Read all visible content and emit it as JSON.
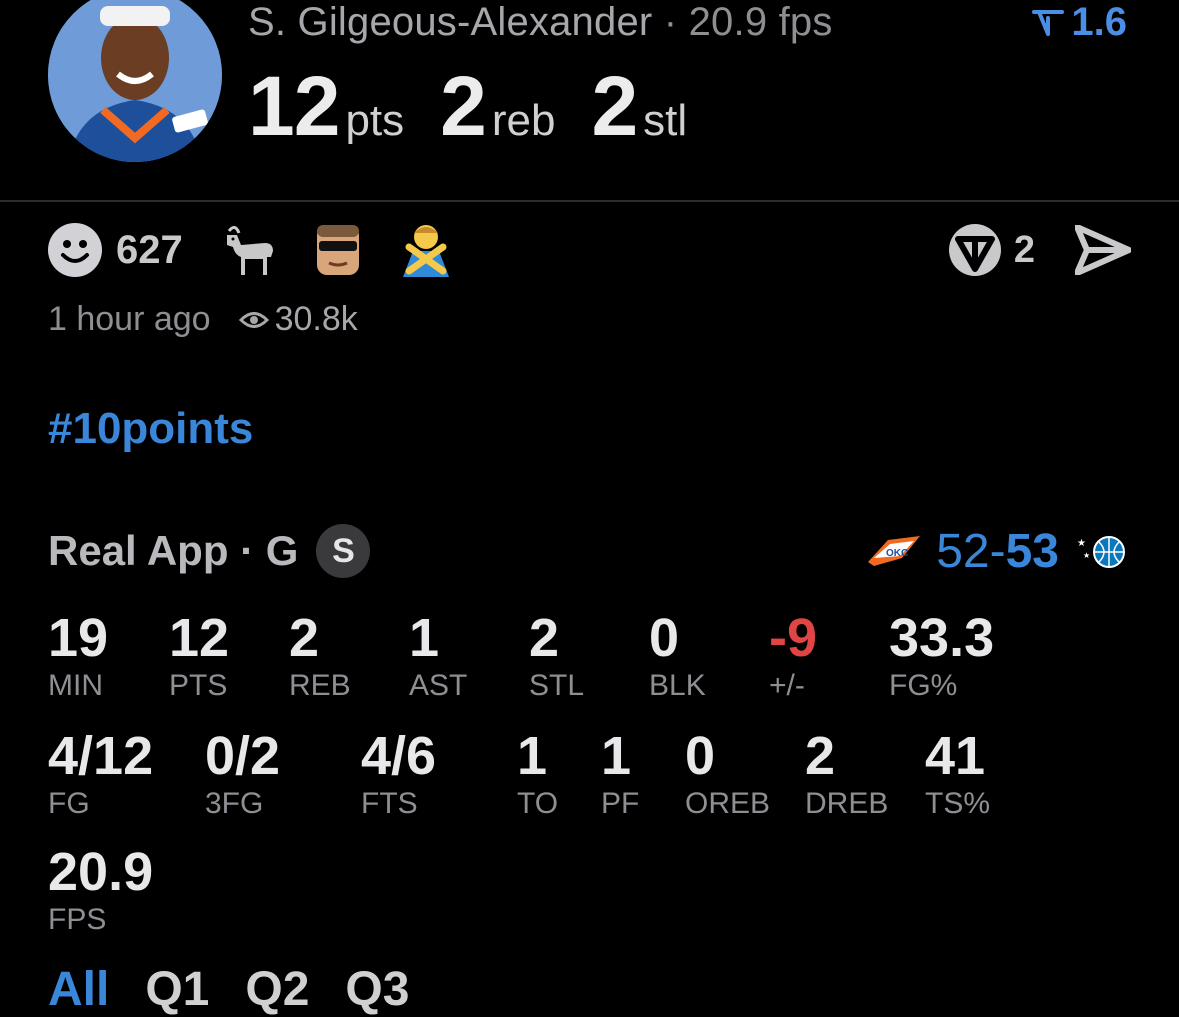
{
  "header": {
    "player_name": "S. Gilgeous-Alexander",
    "separator": "·",
    "fps_text": "20.9 fps",
    "trend_value": "1.6",
    "statline": [
      {
        "value": "12",
        "unit": "pts"
      },
      {
        "value": "2",
        "unit": "reb"
      },
      {
        "value": "2",
        "unit": "stl"
      }
    ]
  },
  "reactions": {
    "count": "627",
    "emoji_icons": [
      "goat-emoji-icon",
      "player-face-icon",
      "person-gesturing-no-icon"
    ],
    "share_count": "2"
  },
  "meta": {
    "time_ago": "1 hour ago",
    "views": "30.8k"
  },
  "hashtag": "#10points",
  "game": {
    "title": "Real App · G",
    "badge": "S",
    "score_home": "52",
    "score_dash": "-",
    "score_away": "53"
  },
  "stats": {
    "row1": [
      {
        "value": "19",
        "label": "MIN"
      },
      {
        "value": "12",
        "label": "PTS"
      },
      {
        "value": "2",
        "label": "REB"
      },
      {
        "value": "1",
        "label": "AST"
      },
      {
        "value": "2",
        "label": "STL"
      },
      {
        "value": "0",
        "label": "BLK"
      },
      {
        "value": "-9",
        "label": "+/-"
      },
      {
        "value": "33.3",
        "label": "FG%"
      }
    ],
    "row2": [
      {
        "value": "4/12",
        "label": "FG"
      },
      {
        "value": "0/2",
        "label": "3FG"
      },
      {
        "value": "4/6",
        "label": "FTS"
      },
      {
        "value": "1",
        "label": "TO"
      },
      {
        "value": "1",
        "label": "PF"
      },
      {
        "value": "0",
        "label": "OREB"
      },
      {
        "value": "2",
        "label": "DREB"
      },
      {
        "value": "41",
        "label": "TS%"
      }
    ],
    "row3": [
      {
        "value": "20.9",
        "label": "FPS"
      }
    ]
  },
  "tabs": [
    "All",
    "Q1",
    "Q2",
    "Q3"
  ],
  "colors": {
    "accent": "#3a86d9",
    "negative": "#e04444",
    "muted": "#8e8e93"
  }
}
